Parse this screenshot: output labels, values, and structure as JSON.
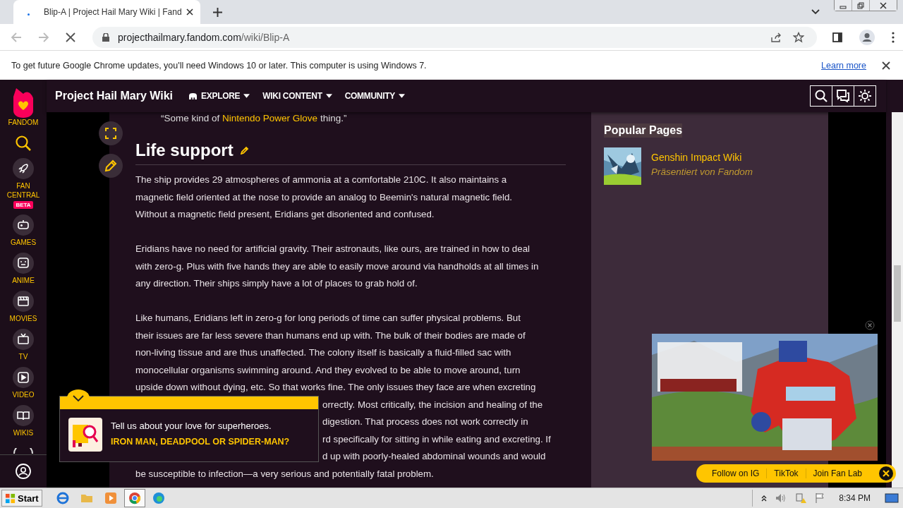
{
  "browser": {
    "tab": {
      "title": "Blip-A | Project Hail Mary Wiki | Fand",
      "selected": true
    },
    "address": {
      "host": "projecthailmary.fandom.com",
      "path": "/wiki/Blip-A"
    },
    "infobar": {
      "message": "To get future Google Chrome updates, you'll need Windows 10 or later. This computer is using Windows 7.",
      "link": "Learn more"
    }
  },
  "rail": {
    "logo": "FANDOM",
    "items": [
      {
        "kind": "search"
      },
      {
        "kind": "rocket",
        "label": "FAN CENTRAL",
        "badge": "BETA"
      },
      {
        "kind": "gamepad",
        "label": "GAMES"
      },
      {
        "kind": "anime",
        "label": "ANIME"
      },
      {
        "kind": "movies",
        "label": "MOVIES"
      },
      {
        "kind": "tv",
        "label": "TV"
      },
      {
        "kind": "video",
        "label": "VIDEO"
      },
      {
        "kind": "book",
        "label": "WIKIS"
      }
    ]
  },
  "header": {
    "wiki_title": "Project Hail Mary Wiki",
    "menus": [
      {
        "label": "EXPLORE",
        "icon": true
      },
      {
        "label": "WIKI CONTENT",
        "icon": false
      },
      {
        "label": "COMMUNITY",
        "icon": false
      }
    ]
  },
  "article": {
    "quote": {
      "before": "“Some kind of ",
      "link": "Nintendo Power Glove",
      "after": " thing.”"
    },
    "heading": "Life support",
    "paragraphs": [
      {
        "lines": [
          {
            "kind": "full",
            "text": "The ship provides 29 atmospheres of ammonia at a comfortable 210C. It also maintains a"
          },
          {
            "kind": "full",
            "text": "magnetic field oriented at the nose to provide an analog to Beemin's natural magnetic field."
          },
          {
            "kind": "full",
            "text": "Without a magnetic field present, Eridians get disoriented and confused."
          }
        ]
      },
      {
        "lines": [
          {
            "kind": "full",
            "text": "Eridians have no need for artificial gravity. Their astronauts, like ours, are trained in how to deal"
          },
          {
            "kind": "full",
            "text": "with zero-g. Plus with five hands they are able to easily move around via handholds at all times in"
          },
          {
            "kind": "full",
            "text": "any direction. Their ships simply have a lot of places to grab hold of."
          }
        ]
      },
      {
        "lines": [
          {
            "kind": "full",
            "text": "Like humans, Eridians left in zero-g for long periods of time can suffer physical problems. But"
          },
          {
            "kind": "full",
            "text": "their issues are far less severe than humans end up with. The bulk of their bodies are made of"
          },
          {
            "kind": "full",
            "text": "non-living tissue and are thus unaffected. The colony itself is basically a fluid-filled sac with"
          },
          {
            "kind": "full",
            "text": "monocellular organisms swimming around. And they evolved to be able to move around, turn"
          },
          {
            "kind": "full",
            "text": "upside down without dying, etc. So that works fine. The only issues they face are when excreting"
          },
          {
            "kind": "partial",
            "text": "orrectly. Most critically, the incision and healing of the"
          },
          {
            "kind": "partial",
            "text": "digestion. That process does not work correctly in"
          },
          {
            "kind": "partial",
            "text": "rd specifically for sitting in while eating and excreting. If"
          },
          {
            "kind": "partial",
            "text": "d up with poorly-healed abdominal wounds and would"
          },
          {
            "kind": "full",
            "text": "be susceptible to infection—a very serious and potentially fatal problem."
          }
        ]
      }
    ]
  },
  "popular": {
    "heading": "Popular Pages",
    "items": [
      {
        "title": "Genshin Impact Wiki",
        "subtitle": "Präsentiert von Fandom"
      }
    ]
  },
  "survey": {
    "question": "Tell us about your love for superheroes.",
    "prompt": "IRON MAN, DEADPOOL OR SPIDER-MAN?"
  },
  "video": {
    "links": [
      "Follow on IG",
      "TikTok",
      "Join Fan Lab"
    ]
  },
  "taskbar": {
    "start": "Start",
    "clock": "8:34 PM"
  }
}
